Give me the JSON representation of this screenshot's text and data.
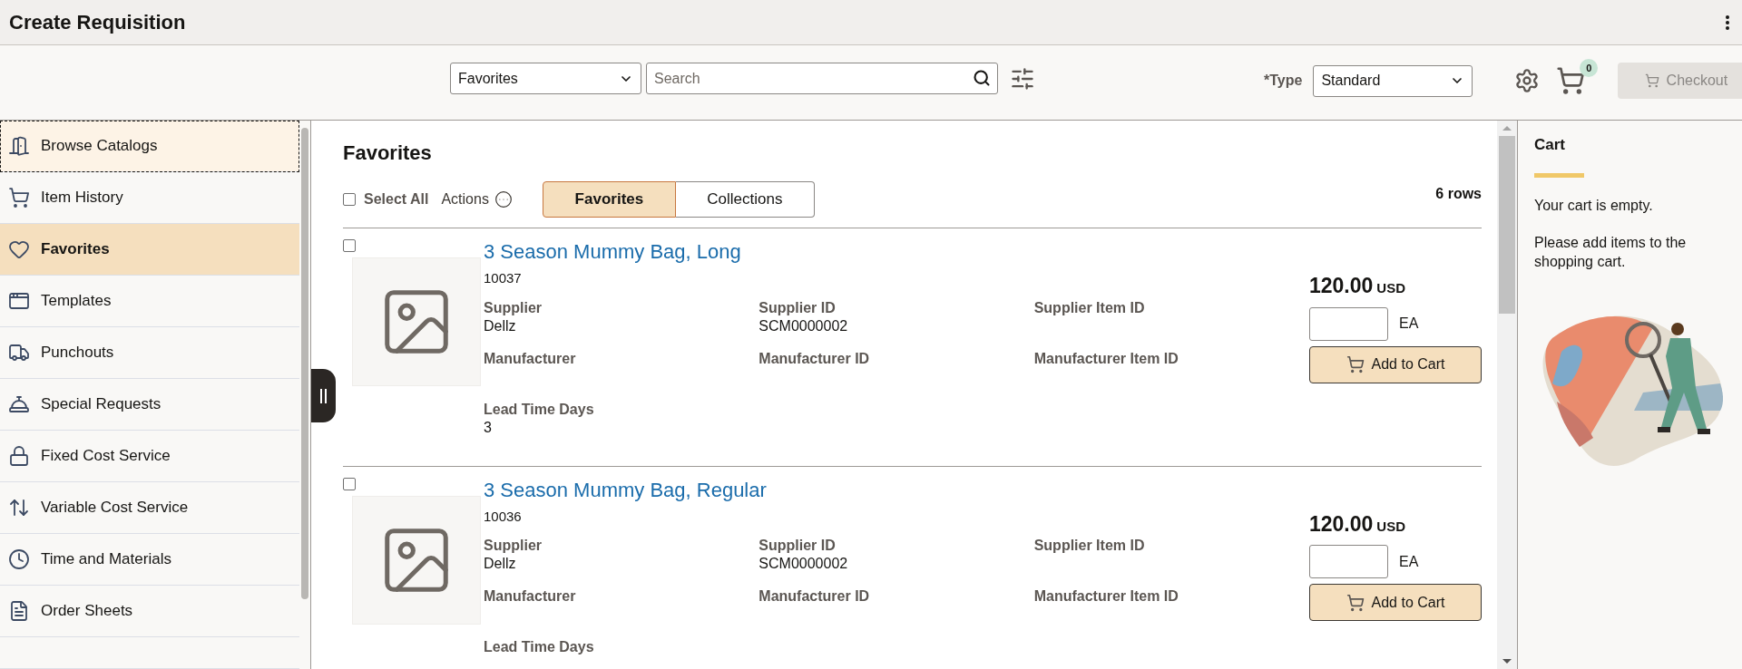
{
  "header": {
    "title": "Create Requisition"
  },
  "toolbar": {
    "source_select": {
      "value": "Favorites"
    },
    "search": {
      "placeholder": "Search"
    },
    "type": {
      "label": "*Type",
      "value": "Standard"
    },
    "cart_count": "0",
    "checkout": {
      "label": "Checkout",
      "disabled": true
    }
  },
  "sidebar": {
    "items": [
      {
        "label": "Browse Catalogs",
        "selected": false,
        "focused": true
      },
      {
        "label": "Item History",
        "selected": false,
        "focused": false
      },
      {
        "label": "Favorites",
        "selected": true,
        "focused": false
      },
      {
        "label": "Templates",
        "selected": false,
        "focused": false
      },
      {
        "label": "Punchouts",
        "selected": false,
        "focused": false
      },
      {
        "label": "Special Requests",
        "selected": false,
        "focused": false
      },
      {
        "label": "Fixed Cost Service",
        "selected": false,
        "focused": false
      },
      {
        "label": "Variable Cost Service",
        "selected": false,
        "focused": false
      },
      {
        "label": "Time and Materials",
        "selected": false,
        "focused": false
      },
      {
        "label": "Order Sheets",
        "selected": false,
        "focused": false
      }
    ]
  },
  "main": {
    "title": "Favorites",
    "select_all": {
      "label": "Select All",
      "checked": false
    },
    "actions": "Actions",
    "tabs": [
      {
        "label": "Favorites",
        "selected": true
      },
      {
        "label": "Collections",
        "selected": false
      }
    ],
    "row_count": "6 rows",
    "items": [
      {
        "checked": false,
        "name": "3 Season Mummy Bag, Long",
        "id": "10037",
        "price": "120.00",
        "currency": "USD",
        "uom": "EA",
        "button": "Add to Cart",
        "fields": [
          {
            "label": "Supplier",
            "value": "Dellz"
          },
          {
            "label": "Supplier ID",
            "value": "SCM0000002"
          },
          {
            "label": "Supplier Item ID"
          },
          {
            "label": "Manufacturer"
          },
          {
            "label": "Manufacturer ID"
          },
          {
            "label": "Manufacturer Item ID"
          },
          {
            "label": "Lead Time Days",
            "value": "3"
          }
        ]
      },
      {
        "checked": false,
        "name": "3 Season Mummy Bag, Regular",
        "id": "10036",
        "price": "120.00",
        "currency": "USD",
        "uom": "EA",
        "button": "Add to Cart",
        "fields": [
          {
            "label": "Supplier",
            "value": "Dellz"
          },
          {
            "label": "Supplier ID",
            "value": "SCM0000002"
          },
          {
            "label": "Supplier Item ID"
          },
          {
            "label": "Manufacturer"
          },
          {
            "label": "Manufacturer ID"
          },
          {
            "label": "Manufacturer Item ID"
          },
          {
            "label": "Lead Time Days"
          }
        ]
      }
    ]
  },
  "cart": {
    "title": "Cart",
    "messages": [
      "Your cart is empty.",
      "Please add items to the shopping cart."
    ]
  }
}
